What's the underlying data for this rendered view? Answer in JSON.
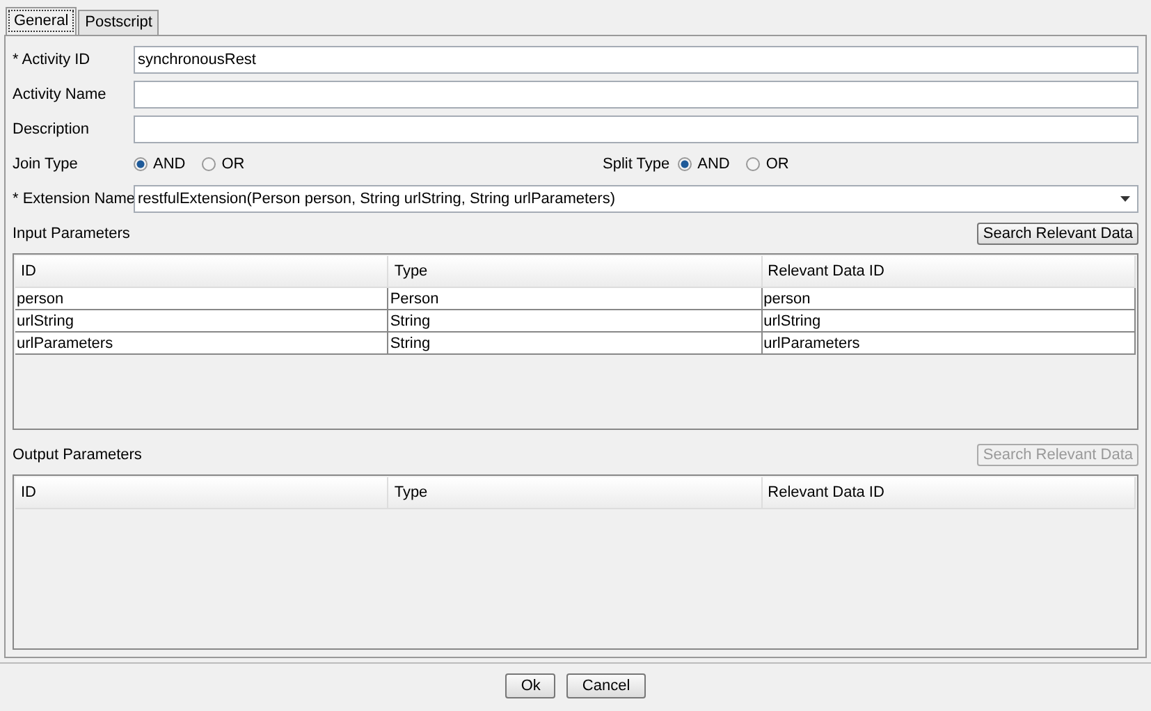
{
  "tabs": [
    {
      "label": "General",
      "selected": true
    },
    {
      "label": "Postscript",
      "selected": false
    }
  ],
  "fields": [
    {
      "kind": "text",
      "label": "* Activity ID",
      "value": "synchronousRest"
    },
    {
      "kind": "text",
      "label": "Activity Name"
    },
    {
      "kind": "text",
      "label": "Description"
    }
  ],
  "join_type": {
    "label": "Join Type",
    "options": [
      {
        "label": "AND",
        "selected": true
      },
      {
        "label": "OR",
        "selected": false
      }
    ]
  },
  "split_type": {
    "label": "Split Type",
    "options": [
      {
        "label": "AND",
        "selected": true
      },
      {
        "label": "OR",
        "selected": false
      }
    ]
  },
  "extension": {
    "label": "* Extension Name",
    "value": "restfulExtension(Person person, String urlString, String urlParameters)"
  },
  "sections": [
    {
      "title": "Input Parameters",
      "button": {
        "label": "Search Relevant Data",
        "disabled": false
      },
      "columns": [
        "ID",
        "Type",
        "Relevant Data ID"
      ],
      "rows": [
        [
          "person",
          "Person",
          "person"
        ],
        [
          "urlString",
          "String",
          "urlString"
        ],
        [
          "urlParameters",
          "String",
          "urlParameters"
        ]
      ]
    },
    {
      "title": "Output Parameters",
      "button": {
        "label": "Search Relevant Data",
        "disabled": true
      },
      "columns": [
        "ID",
        "Type",
        "Relevant Data ID"
      ]
    }
  ],
  "buttons": [
    "Ok",
    "Cancel"
  ]
}
